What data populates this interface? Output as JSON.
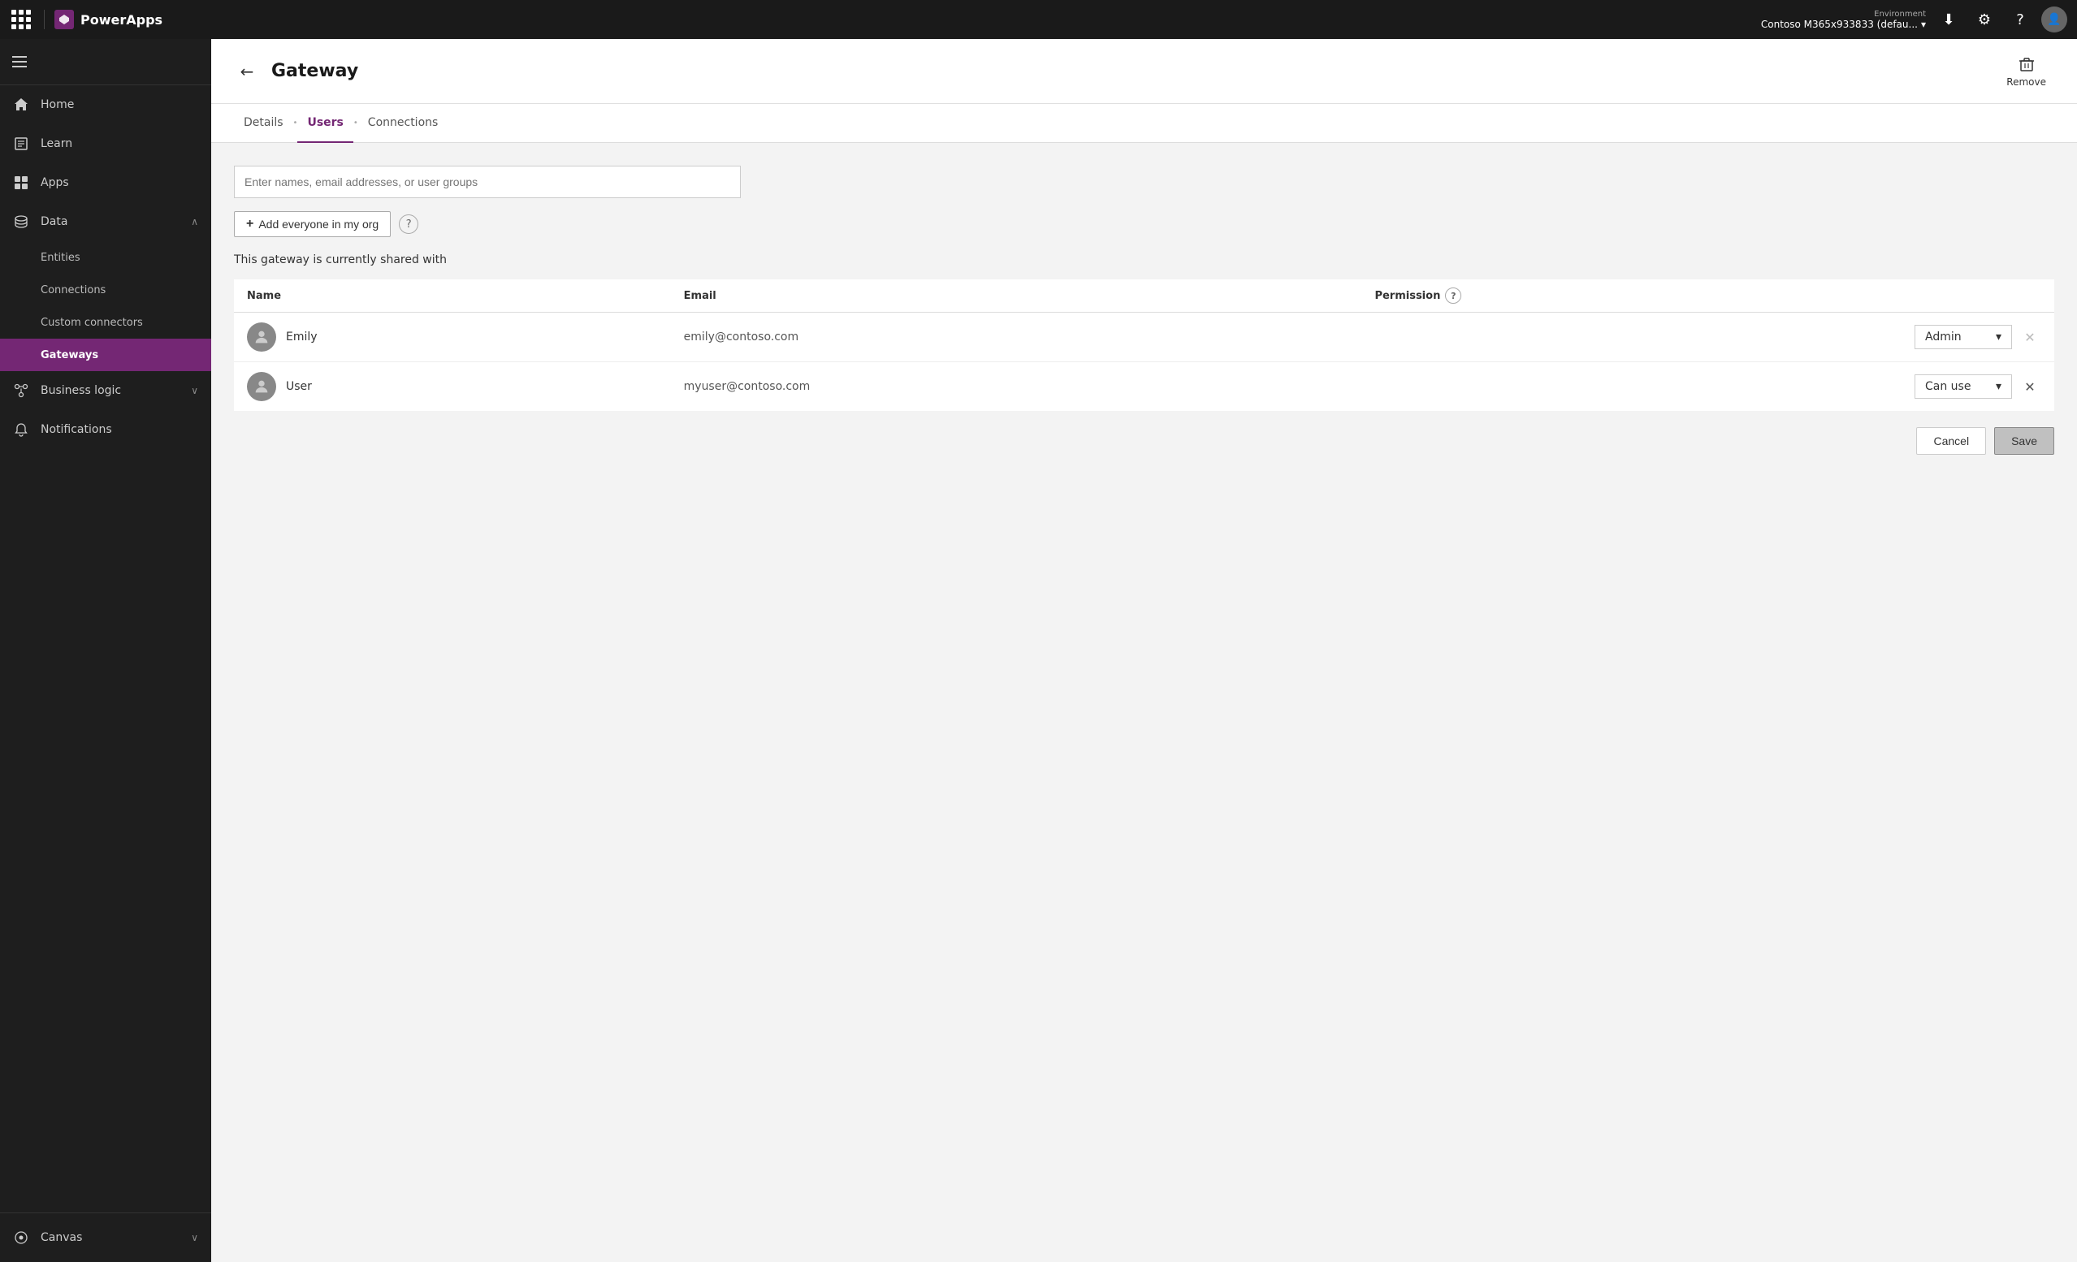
{
  "topnav": {
    "brand_name": "PowerApps",
    "environment_label": "Environment",
    "environment_value": "Contoso M365x933833 (defau...",
    "download_icon": "↓",
    "settings_icon": "⚙",
    "help_icon": "?"
  },
  "sidebar": {
    "menu_icon": "☰",
    "items": [
      {
        "id": "home",
        "label": "Home",
        "icon": "home"
      },
      {
        "id": "learn",
        "label": "Learn",
        "icon": "book"
      },
      {
        "id": "apps",
        "label": "Apps",
        "icon": "apps"
      },
      {
        "id": "data",
        "label": "Data",
        "icon": "data",
        "has_chevron": true,
        "expanded": true
      },
      {
        "id": "entities",
        "label": "Entities",
        "sub": true
      },
      {
        "id": "connections",
        "label": "Connections",
        "sub": true
      },
      {
        "id": "custom-connectors",
        "label": "Custom connectors",
        "sub": true
      },
      {
        "id": "gateways",
        "label": "Gateways",
        "sub": true,
        "active": true
      },
      {
        "id": "business-logic",
        "label": "Business logic",
        "icon": "logic",
        "has_chevron": true
      },
      {
        "id": "notifications",
        "label": "Notifications",
        "icon": "bell"
      }
    ],
    "bottom": [
      {
        "id": "canvas",
        "label": "Canvas",
        "icon": "canvas",
        "has_chevron": true
      }
    ]
  },
  "page": {
    "title": "Gateway",
    "remove_label": "Remove",
    "tabs": [
      {
        "id": "details",
        "label": "Details",
        "active": false
      },
      {
        "id": "users",
        "label": "Users",
        "active": true
      },
      {
        "id": "connections",
        "label": "Connections",
        "active": false
      }
    ],
    "search_placeholder": "Enter names, email addresses, or user groups",
    "add_everyone_label": "Add everyone in my org",
    "shared_with_text": "This gateway is currently shared with",
    "table": {
      "col_name": "Name",
      "col_email": "Email",
      "col_permission": "Permission",
      "rows": [
        {
          "id": "emily",
          "name": "Emily",
          "email": "emily@contoso.com",
          "permission": "Admin",
          "can_remove": false
        },
        {
          "id": "user",
          "name": "User",
          "email": "myuser@contoso.com",
          "permission": "Can use",
          "can_remove": true
        }
      ]
    },
    "cancel_label": "Cancel",
    "save_label": "Save"
  }
}
